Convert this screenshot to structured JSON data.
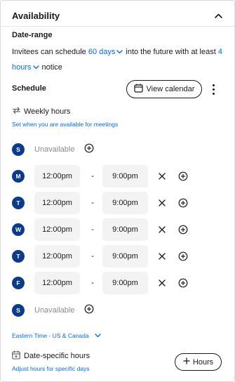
{
  "header": {
    "title": "Availability"
  },
  "date_range": {
    "title": "Date-range",
    "prefix": "Invitees can schedule",
    "days_value": "60 days",
    "middle": "into the future with at least",
    "notice_value": "4 hours",
    "suffix": "notice"
  },
  "schedule": {
    "title": "Schedule",
    "view_calendar_label": "View calendar",
    "weekly_label": "Weekly hours",
    "weekly_sub": "Set when you are available for meetings",
    "dash": "-",
    "days": [
      {
        "letter": "S",
        "unavailable": "Unavailable"
      },
      {
        "letter": "M",
        "start": "12:00pm",
        "end": "9:00pm"
      },
      {
        "letter": "T",
        "start": "12:00pm",
        "end": "9:00pm"
      },
      {
        "letter": "W",
        "start": "12:00pm",
        "end": "9:00pm"
      },
      {
        "letter": "T",
        "start": "12:00pm",
        "end": "9:00pm"
      },
      {
        "letter": "F",
        "start": "12:00pm",
        "end": "9:00pm"
      },
      {
        "letter": "S",
        "unavailable": "Unavailable"
      }
    ],
    "timezone": "Eastern Time - US & Canada"
  },
  "date_specific": {
    "label": "Date-specific hours",
    "sub": "Adjust hours for specific days",
    "button_label": "Hours"
  },
  "colors": {
    "accent": "#006bff",
    "badge": "#0b3c8c",
    "field_bg": "#f3f3f3",
    "muted": "#8c8c8c"
  },
  "icons": [
    "chevron-up-icon",
    "chevron-down-icon",
    "calendar-icon",
    "more-vertical-icon",
    "repeat-icon",
    "plus-circle-icon",
    "close-icon",
    "calendar-plus-icon",
    "plus-icon"
  ]
}
